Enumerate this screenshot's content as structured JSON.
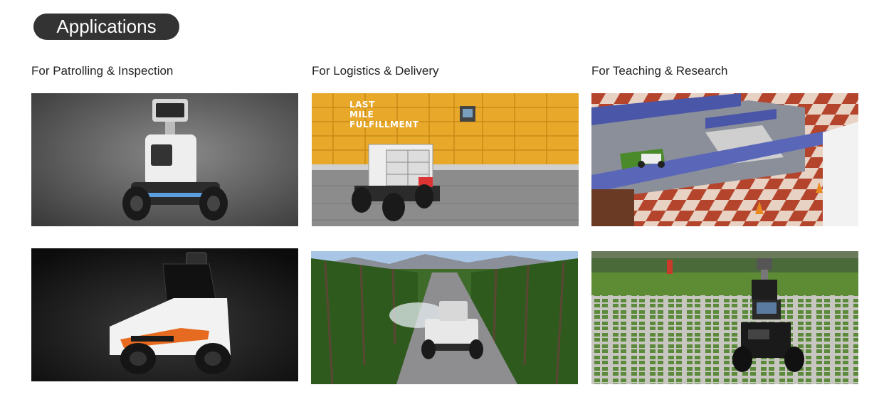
{
  "header": {
    "title": "Applications"
  },
  "columns": [
    {
      "title": "For Patrolling & Inspection",
      "images": [
        "patrol-robot-studio",
        "patrol-robot-dark"
      ]
    },
    {
      "title": "For Logistics & Delivery",
      "images": [
        "delivery-robot-lockers",
        "sprayer-robot-vineyard"
      ],
      "overlay_lines": [
        "LAST",
        "MILE",
        "FULFILLMENT"
      ]
    },
    {
      "title": "For Teaching & Research",
      "images": [
        "robot-maze-simulation",
        "robot-on-grass-pavers"
      ]
    }
  ],
  "colors": {
    "pill_background": "#333333",
    "pill_text": "#ffffff",
    "title_text": "#222222",
    "locker_yellow": "#e8a82a",
    "checker_red": "#b5442c"
  }
}
